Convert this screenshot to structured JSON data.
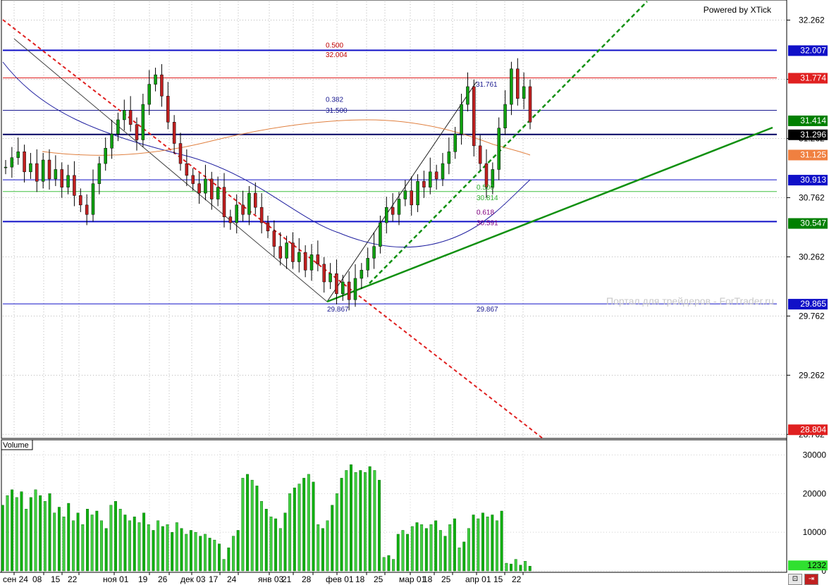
{
  "header": {
    "powered_by": "Powered by XTick"
  },
  "watermark": "Портал для трейдеров - ForTrader.ru",
  "panels": {
    "volume_label": "Volume"
  },
  "chart_data": [
    {
      "type": "candlestick",
      "title": "",
      "x_ticks": [
        "сен 24",
        "08",
        "15",
        "22",
        "ноя 01",
        "19",
        "26",
        "дек 03",
        "17",
        "24",
        "янв 03",
        "21",
        "28",
        "фев 01",
        "18",
        "25",
        "мар 01",
        "18",
        "25",
        "апр 01",
        "15",
        "22"
      ],
      "y_ticks": [
        32.262,
        31.762,
        31.262,
        30.762,
        30.262,
        29.762,
        29.262,
        28.762
      ],
      "ylim": [
        28.74,
        32.42
      ],
      "grid": true,
      "close_profile": [
        31.02,
        31.1,
        31.15,
        30.98,
        31.05,
        30.9,
        31.08,
        30.92,
        31.0,
        30.85,
        30.95,
        30.78,
        30.7,
        30.62,
        30.88,
        31.05,
        31.18,
        31.3,
        31.42,
        31.5,
        31.38,
        31.25,
        31.55,
        31.72,
        31.8,
        31.62,
        31.4,
        31.22,
        31.05,
        30.95,
        30.88,
        30.8,
        30.92,
        30.75,
        30.85,
        30.6,
        30.55,
        30.7,
        30.62,
        30.8,
        30.68,
        30.55,
        30.48,
        30.35,
        30.25,
        30.38,
        30.22,
        30.3,
        30.15,
        30.28,
        30.2,
        30.05,
        30.12,
        29.95,
        30.05,
        29.9,
        30.08,
        30.15,
        30.25,
        30.35,
        30.55,
        30.68,
        30.62,
        30.75,
        30.82,
        30.7,
        30.9,
        30.85,
        30.98,
        30.92,
        31.05,
        31.15,
        31.3,
        31.55,
        31.7,
        31.2,
        31.05,
        30.85,
        31.0,
        31.35,
        31.55,
        31.85,
        31.6,
        31.7,
        31.4
      ],
      "price_labels": [
        {
          "value": "32.007",
          "bg": "#1010c8",
          "fg": "#ffffff",
          "y": 32.007
        },
        {
          "value": "31.774",
          "bg": "#e02020",
          "fg": "#ffffff",
          "y": 31.774
        },
        {
          "value": "31.414",
          "bg": "#008000",
          "fg": "#ffffff",
          "y": 31.414
        },
        {
          "value": "31.296",
          "bg": "#000000",
          "fg": "#ffffff",
          "y": 31.296
        },
        {
          "value": "31.125",
          "bg": "#f08040",
          "fg": "#ffffff",
          "y": 31.125
        },
        {
          "value": "30.913",
          "bg": "#1010c8",
          "fg": "#ffffff",
          "y": 30.913
        },
        {
          "value": "30.547",
          "bg": "#008000",
          "fg": "#ffffff",
          "y": 30.547
        },
        {
          "value": "29.865",
          "bg": "#1010c8",
          "fg": "#ffffff",
          "y": 29.865
        },
        {
          "value": "28.804",
          "bg": "#e02020",
          "fg": "#ffffff",
          "y": 28.804
        }
      ],
      "annotations": [
        {
          "text": "0.500",
          "color": "#c00000",
          "x": 462,
          "y": 32.03
        },
        {
          "text": "32.004",
          "color": "#c00000",
          "x": 462,
          "y": 31.95
        },
        {
          "text": "0.382",
          "color": "#1a1a90",
          "x": 462,
          "y": 31.57
        },
        {
          "text": "31.500",
          "color": "#1a1a90",
          "x": 462,
          "y": 31.48
        },
        {
          "text": "31.761",
          "color": "#1a1a90",
          "x": 675,
          "y": 31.7
        },
        {
          "text": "0.500",
          "color": "#30b030",
          "x": 676,
          "y": 30.83
        },
        {
          "text": "30.814",
          "color": "#30b030",
          "x": 676,
          "y": 30.74
        },
        {
          "text": "0.618",
          "color": "#800080",
          "x": 676,
          "y": 30.62
        },
        {
          "text": "30.591",
          "color": "#800080",
          "x": 676,
          "y": 30.53
        },
        {
          "text": "29.867",
          "color": "#1a1a90",
          "x": 464,
          "y": 29.8
        },
        {
          "text": "29.867",
          "color": "#1a1a90",
          "x": 676,
          "y": 29.8
        }
      ]
    },
    {
      "type": "bar",
      "title": "",
      "series_name": "Volume",
      "y_ticks": [
        30000,
        20000,
        10000,
        0
      ],
      "ylim": [
        0,
        31000
      ],
      "last_value": "1232",
      "values_profile": [
        17000,
        19500,
        21000,
        19000,
        20500,
        16000,
        19000,
        21000,
        19500,
        18000,
        20000,
        15000,
        16500,
        14000,
        17500,
        13000,
        15000,
        12000,
        16000,
        14500,
        15500,
        13000,
        11000,
        17000,
        18000,
        16000,
        14500,
        13000,
        14000,
        12500,
        15000,
        12000,
        10500,
        13000,
        11500,
        12000,
        10000,
        12500,
        11000,
        9500,
        10500,
        10000,
        9000,
        9500,
        8500,
        8000,
        7000,
        3000,
        6000,
        9000,
        10500,
        24000,
        25000,
        23500,
        22000,
        18000,
        16000,
        14000,
        13500,
        11000,
        15000,
        20000,
        21500,
        22500,
        24000,
        25000,
        23000,
        12000,
        11000,
        13000,
        17000,
        20000,
        24000,
        26000,
        27500,
        25500,
        26000,
        25500,
        27000,
        26000,
        23500,
        3500,
        4000,
        3000,
        9500,
        10500,
        9500,
        11500,
        12500,
        12000,
        11000,
        12000,
        13000,
        10500,
        9000,
        12000,
        13500,
        6000,
        7500,
        11000,
        14500,
        13500,
        15000,
        14000,
        14500,
        13000,
        15500,
        2000,
        1800,
        3000,
        1500,
        2500,
        1232
      ]
    }
  ]
}
